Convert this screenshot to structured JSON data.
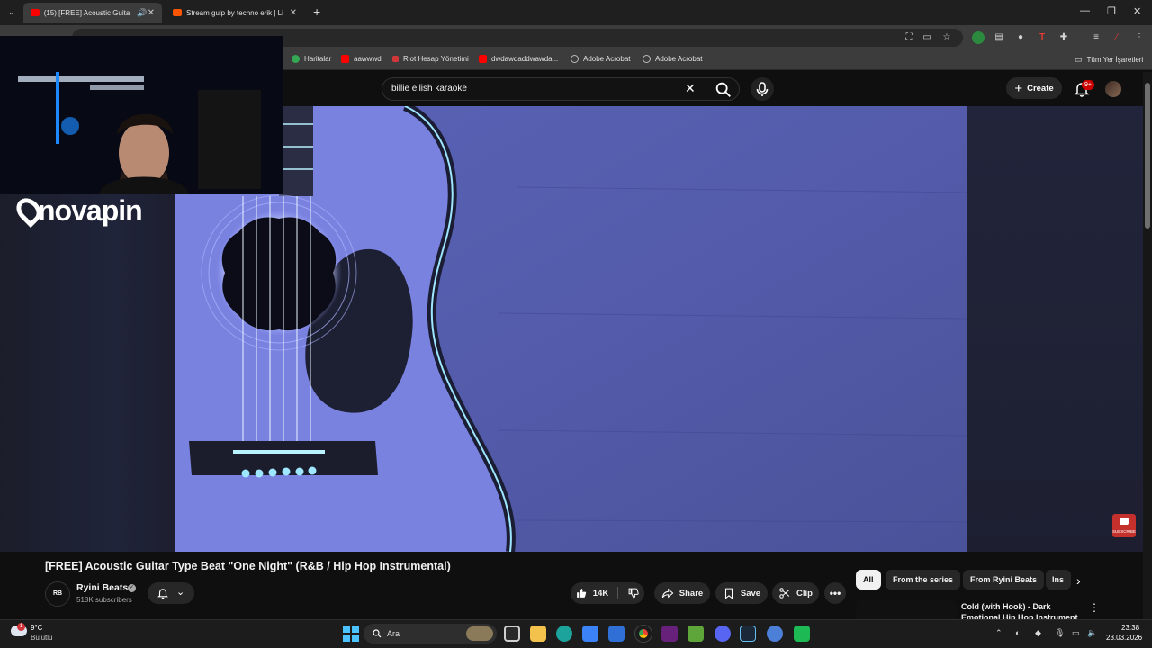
{
  "browser": {
    "tabs": [
      {
        "label": "(15) [FREE] Acoustic Guitar",
        "active": true
      },
      {
        "label": "Stream gulp by techno erik | Li",
        "active": false
      }
    ],
    "bookmarks": [
      {
        "label": "Haritalar",
        "icon": "maps-icon",
        "color": "#34a853"
      },
      {
        "label": "aawwwd",
        "icon": "youtube-icon",
        "color": "#ff0000"
      },
      {
        "label": "Riot Hesap Yönetimi",
        "icon": "riot-icon",
        "color": "#d13639"
      },
      {
        "label": "dwdawdaddwawda...",
        "icon": "youtube-icon",
        "color": "#ff0000"
      },
      {
        "label": "Adobe Acrobat",
        "icon": "globe-icon",
        "color": "#bbbbbb"
      },
      {
        "label": "Adobe Acrobat",
        "icon": "globe-icon",
        "color": "#bbbbbb"
      }
    ],
    "all_bookmarks_label": "Tüm Yer İşaretleri"
  },
  "youtube": {
    "search_value": "billie eilish karaoke",
    "create_label": "Create",
    "notification_count": "9+",
    "overlay_logo_text": "novapin",
    "subscribe_badge": "SUBSCRIBE",
    "video": {
      "title": "[FREE] Acoustic Guitar Type Beat \"One Night\" (R&B / Hip Hop Instrumental)",
      "channel_name": "Ryini Beats",
      "channel_avatar_text": "RB",
      "subscribers": "518K subscribers",
      "likes": "14K",
      "share_label": "Share",
      "save_label": "Save",
      "clip_label": "Clip"
    },
    "chips": [
      "All",
      "From the series",
      "From Ryini Beats",
      "Ins"
    ],
    "recommended": {
      "title": "Cold (with Hook) - Dark Emotional Hip Hop Instrument"
    }
  },
  "taskbar": {
    "weather_temp": "9°C",
    "weather_desc": "Bulutlu",
    "weather_badge": "1",
    "search_label": "Ara",
    "time": "23:38",
    "date": "23.03.2026"
  },
  "colors": {
    "accent_red": "#ff0000",
    "video_blue": "#5a61b8",
    "background": "#0f0f0f"
  }
}
